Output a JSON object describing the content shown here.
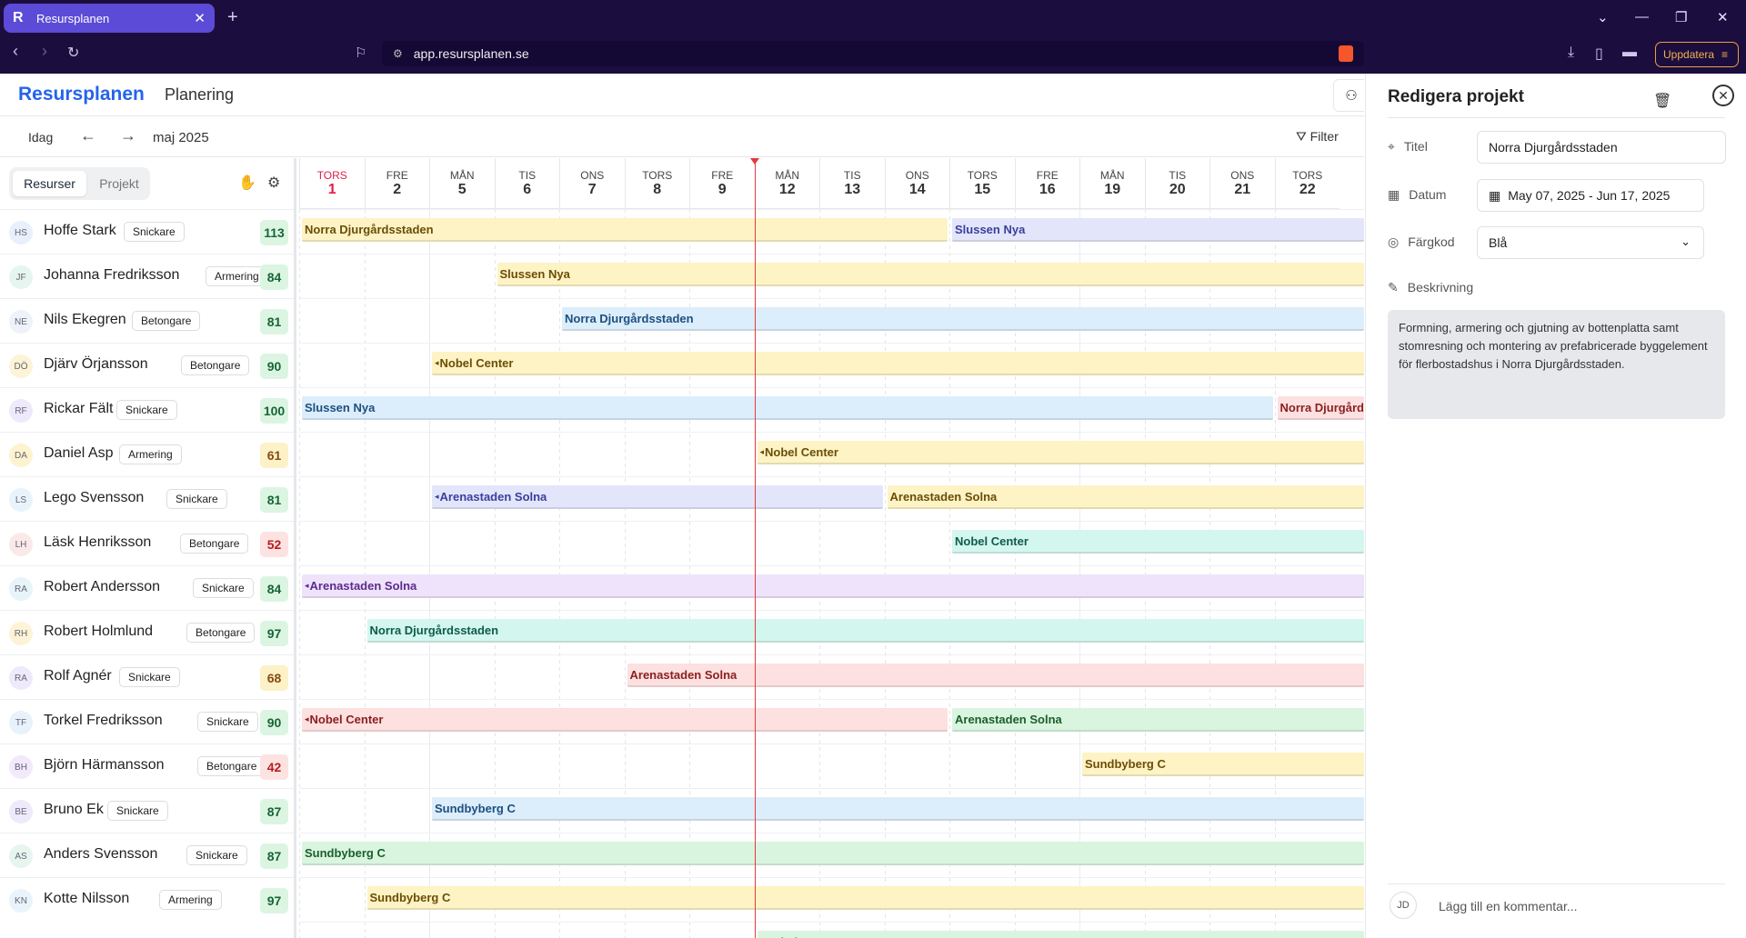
{
  "browser": {
    "tab_title": "Resursplanen",
    "url": "app.resursplanen.se",
    "update_label": "Uppdatera"
  },
  "app": {
    "logo": "Resursplanen",
    "page_title": "Planering"
  },
  "toolbar": {
    "today": "Idag",
    "month": "maj 2025",
    "filter": "Filter"
  },
  "sidebar": {
    "tab_resources": "Resurser",
    "tab_projects": "Projekt"
  },
  "days": [
    {
      "wd": "TORS",
      "d": "1",
      "today": true
    },
    {
      "wd": "FRE",
      "d": "2"
    },
    {
      "wd": "MÅN",
      "d": "5"
    },
    {
      "wd": "TIS",
      "d": "6"
    },
    {
      "wd": "ONS",
      "d": "7"
    },
    {
      "wd": "TORS",
      "d": "8"
    },
    {
      "wd": "FRE",
      "d": "9"
    },
    {
      "wd": "MÅN",
      "d": "12"
    },
    {
      "wd": "TIS",
      "d": "13"
    },
    {
      "wd": "ONS",
      "d": "14"
    },
    {
      "wd": "TORS",
      "d": "15"
    },
    {
      "wd": "FRE",
      "d": "16"
    },
    {
      "wd": "MÅN",
      "d": "19"
    },
    {
      "wd": "TIS",
      "d": "20"
    },
    {
      "wd": "ONS",
      "d": "21"
    },
    {
      "wd": "TORS",
      "d": "22"
    }
  ],
  "resources": [
    {
      "initials": "HS",
      "name": "Hoffe Stark",
      "role": "Snickare",
      "value": "113",
      "status": "green"
    },
    {
      "initials": "JF",
      "name": "Johanna Fredriksson",
      "role": "Armering",
      "value": "84",
      "status": "green"
    },
    {
      "initials": "NE",
      "name": "Nils Ekegren",
      "role": "Betongare",
      "value": "81",
      "status": "green"
    },
    {
      "initials": "DÖ",
      "name": "Djärv Örjansson",
      "role": "Betongare",
      "value": "90",
      "status": "green"
    },
    {
      "initials": "RF",
      "name": "Rickar Fält",
      "role": "Snickare",
      "value": "100",
      "status": "green"
    },
    {
      "initials": "DA",
      "name": "Daniel Asp",
      "role": "Armering",
      "value": "61",
      "status": "yellow"
    },
    {
      "initials": "LS",
      "name": "Lego Svensson",
      "role": "Snickare",
      "value": "81",
      "status": "green"
    },
    {
      "initials": "LH",
      "name": "Läsk Henriksson",
      "role": "Betongare",
      "value": "52",
      "status": "red"
    },
    {
      "initials": "RA",
      "name": "Robert Andersson",
      "role": "Snickare",
      "value": "84",
      "status": "green"
    },
    {
      "initials": "RH",
      "name": "Robert Holmlund",
      "role": "Betongare",
      "value": "97",
      "status": "green"
    },
    {
      "initials": "RA",
      "name": "Rolf Agnér",
      "role": "Snickare",
      "value": "68",
      "status": "yellow"
    },
    {
      "initials": "TF",
      "name": "Torkel Fredriksson",
      "role": "Snickare",
      "value": "90",
      "status": "green"
    },
    {
      "initials": "BH",
      "name": "Björn Härmansson",
      "role": "Betongare",
      "value": "42",
      "status": "red"
    },
    {
      "initials": "BE",
      "name": "Bruno Ek",
      "role": "Snickare",
      "value": "87",
      "status": "green"
    },
    {
      "initials": "AS",
      "name": "Anders Svensson",
      "role": "Snickare",
      "value": "87",
      "status": "green"
    },
    {
      "initials": "KN",
      "name": "Kotte Nilsson",
      "role": "Armering",
      "value": "97",
      "status": "green"
    }
  ],
  "bars": [
    {
      "row": 0,
      "start": 0,
      "end": 10,
      "label": "Norra Djurgårdsstaden",
      "color": "yellow"
    },
    {
      "row": 0,
      "start": 10,
      "end": 17,
      "label": "Slussen Nya",
      "color": "indigo"
    },
    {
      "row": 1,
      "start": 3,
      "end": 17,
      "label": "Slussen Nya",
      "color": "yellow"
    },
    {
      "row": 2,
      "start": 4,
      "end": 17,
      "label": "Norra Djurgårdsstaden",
      "color": "blue"
    },
    {
      "row": 3,
      "start": 2,
      "end": 17,
      "label": "Nobel Center",
      "color": "yellow",
      "cont": true
    },
    {
      "row": 4,
      "start": 0,
      "end": 15,
      "label": "Slussen Nya",
      "color": "blue"
    },
    {
      "row": 4,
      "start": 15,
      "end": 17,
      "label": "Norra Djurgårdsstaden",
      "color": "red"
    },
    {
      "row": 5,
      "start": 7,
      "end": 17,
      "label": "Nobel Center",
      "color": "yellow",
      "cont": true
    },
    {
      "row": 6,
      "start": 2,
      "end": 9,
      "label": "Arenastaden Solna",
      "color": "indigo",
      "cont": true
    },
    {
      "row": 6,
      "start": 9,
      "end": 17,
      "label": "Arenastaden Solna",
      "color": "yellow"
    },
    {
      "row": 7,
      "start": 10,
      "end": 17,
      "label": "Nobel Center",
      "color": "teal"
    },
    {
      "row": 8,
      "start": 0,
      "end": 17,
      "label": "Arenastaden Solna",
      "color": "purple",
      "cont": true
    },
    {
      "row": 9,
      "start": 1,
      "end": 17,
      "label": "Norra Djurgårdsstaden",
      "color": "teal"
    },
    {
      "row": 10,
      "start": 5,
      "end": 17,
      "label": "Arenastaden Solna",
      "color": "red"
    },
    {
      "row": 11,
      "start": 0,
      "end": 10,
      "label": "Nobel Center",
      "color": "red",
      "cont": true
    },
    {
      "row": 11,
      "start": 10,
      "end": 17,
      "label": "Arenastaden Solna",
      "color": "green"
    },
    {
      "row": 12,
      "start": 12,
      "end": 17,
      "label": "Sundbyberg C",
      "color": "yellow"
    },
    {
      "row": 13,
      "start": 2,
      "end": 17,
      "label": "Sundbyberg C",
      "color": "blue"
    },
    {
      "row": 14,
      "start": 0,
      "end": 17,
      "label": "Sundbyberg C",
      "color": "green"
    },
    {
      "row": 15,
      "start": 1,
      "end": 17,
      "label": "Sundbyberg C",
      "color": "yellow"
    },
    {
      "row": 16,
      "start": 7,
      "end": 17,
      "label": "Nobel Center",
      "color": "green",
      "cont": true
    }
  ],
  "colors": {
    "yellow": {
      "bg": "#fdf3c4",
      "fg": "#6b4d07"
    },
    "indigo": {
      "bg": "#e3e5fb",
      "fg": "#3b3f9c"
    },
    "blue": {
      "bg": "#dcedfb",
      "fg": "#1d4f80"
    },
    "red": {
      "bg": "#fde0e0",
      "fg": "#8a1f1f"
    },
    "teal": {
      "bg": "#d3f6ee",
      "fg": "#0f5b4c"
    },
    "purple": {
      "bg": "#efe3fb",
      "fg": "#5b2a8c"
    },
    "green": {
      "bg": "#d9f5df",
      "fg": "#1b5e2b"
    },
    "status_green": {
      "bg": "#dcf5e3",
      "fg": "#166534"
    },
    "status_yellow": {
      "bg": "#fdf1c7",
      "fg": "#854d0e"
    },
    "status_red": {
      "bg": "#fde2e2",
      "fg": "#b91c1c"
    }
  },
  "panel": {
    "title": "Redigera projekt",
    "title_label": "Titel",
    "title_value": "Norra Djurgårdsstaden",
    "date_label": "Datum",
    "date_value": "May 07, 2025 - Jun 17, 2025",
    "color_label": "Färgkod",
    "color_value": "Blå",
    "desc_label": "Beskrivning",
    "desc_value": "Formning, armering och gjutning av bottenplatta samt stomresning och montering av prefabricerade byggelement för flerbostadshus i Norra Djurgårdsstaden.",
    "comment_avatar": "JD",
    "comment_placeholder": "Lägg till en kommentar..."
  }
}
